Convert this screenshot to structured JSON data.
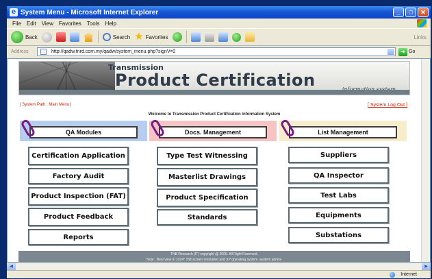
{
  "window": {
    "title": "System Menu - Microsoft Internet Explorer"
  },
  "menubar": [
    "File",
    "Edit",
    "View",
    "Favorites",
    "Tools",
    "Help"
  ],
  "toolbar": {
    "back_label": "Back",
    "search_label": "Search",
    "favorites_label": "Favorites",
    "links_label": "Links"
  },
  "address": {
    "label": "Address",
    "url": "http://qadw.tnrd.com.my/qadw/system_menu.php?signV=2",
    "go_label": "Go"
  },
  "banner": {
    "small": "Transmission",
    "big": "Product Certification",
    "sub": "information system"
  },
  "page": {
    "syspath": "[ System Path : Main Menu ]",
    "logout": "[ System Log Out ]",
    "welcome": "Welcome to Transmission Product Certification Information System"
  },
  "categories": {
    "qa": "QA Modules",
    "docs": "Docs. Management",
    "list": "List  Management"
  },
  "modules": {
    "col1": [
      "Certification Application",
      "Factory Audit",
      "Product Inspection (FAT)",
      "Product Feedback",
      "Reports"
    ],
    "col2": [
      "Type Test Witnessing",
      "Masterlist Drawings",
      "Product Specification",
      "Standards"
    ],
    "col3": [
      "Suppliers",
      "QA Inspector",
      "Test Labs",
      "Equipments",
      "Substations"
    ]
  },
  "footer": {
    "line1": "TNB Research (IT) copyright @ 2006. All Right Reserved.",
    "line2": "Note : Best view in 1024* 768 screen resolution and XP operating system -system admin-"
  },
  "status": {
    "zone": "Internet"
  }
}
